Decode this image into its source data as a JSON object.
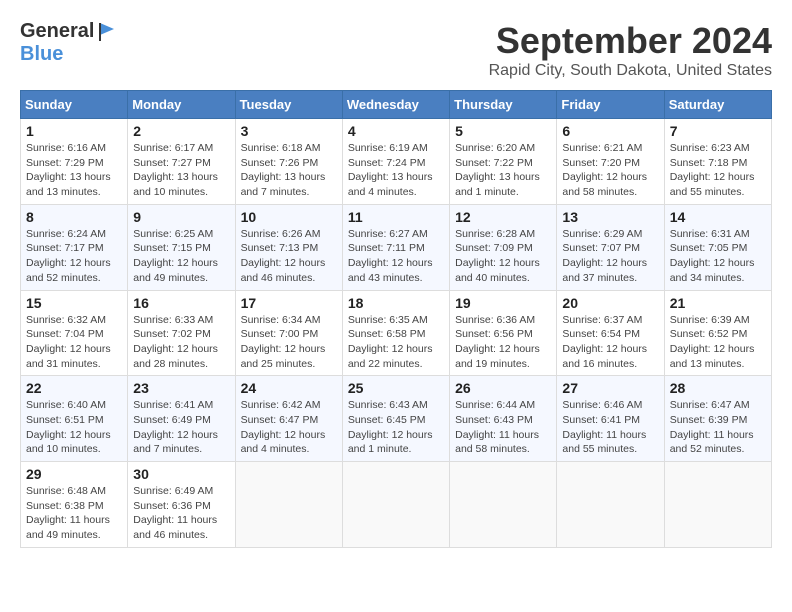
{
  "header": {
    "logo_general": "General",
    "logo_blue": "Blue",
    "month_title": "September 2024",
    "location": "Rapid City, South Dakota, United States"
  },
  "days_of_week": [
    "Sunday",
    "Monday",
    "Tuesday",
    "Wednesday",
    "Thursday",
    "Friday",
    "Saturday"
  ],
  "weeks": [
    [
      {
        "day": "1",
        "detail": "Sunrise: 6:16 AM\nSunset: 7:29 PM\nDaylight: 13 hours\nand 13 minutes."
      },
      {
        "day": "2",
        "detail": "Sunrise: 6:17 AM\nSunset: 7:27 PM\nDaylight: 13 hours\nand 10 minutes."
      },
      {
        "day": "3",
        "detail": "Sunrise: 6:18 AM\nSunset: 7:26 PM\nDaylight: 13 hours\nand 7 minutes."
      },
      {
        "day": "4",
        "detail": "Sunrise: 6:19 AM\nSunset: 7:24 PM\nDaylight: 13 hours\nand 4 minutes."
      },
      {
        "day": "5",
        "detail": "Sunrise: 6:20 AM\nSunset: 7:22 PM\nDaylight: 13 hours\nand 1 minute."
      },
      {
        "day": "6",
        "detail": "Sunrise: 6:21 AM\nSunset: 7:20 PM\nDaylight: 12 hours\nand 58 minutes."
      },
      {
        "day": "7",
        "detail": "Sunrise: 6:23 AM\nSunset: 7:18 PM\nDaylight: 12 hours\nand 55 minutes."
      }
    ],
    [
      {
        "day": "8",
        "detail": "Sunrise: 6:24 AM\nSunset: 7:17 PM\nDaylight: 12 hours\nand 52 minutes."
      },
      {
        "day": "9",
        "detail": "Sunrise: 6:25 AM\nSunset: 7:15 PM\nDaylight: 12 hours\nand 49 minutes."
      },
      {
        "day": "10",
        "detail": "Sunrise: 6:26 AM\nSunset: 7:13 PM\nDaylight: 12 hours\nand 46 minutes."
      },
      {
        "day": "11",
        "detail": "Sunrise: 6:27 AM\nSunset: 7:11 PM\nDaylight: 12 hours\nand 43 minutes."
      },
      {
        "day": "12",
        "detail": "Sunrise: 6:28 AM\nSunset: 7:09 PM\nDaylight: 12 hours\nand 40 minutes."
      },
      {
        "day": "13",
        "detail": "Sunrise: 6:29 AM\nSunset: 7:07 PM\nDaylight: 12 hours\nand 37 minutes."
      },
      {
        "day": "14",
        "detail": "Sunrise: 6:31 AM\nSunset: 7:05 PM\nDaylight: 12 hours\nand 34 minutes."
      }
    ],
    [
      {
        "day": "15",
        "detail": "Sunrise: 6:32 AM\nSunset: 7:04 PM\nDaylight: 12 hours\nand 31 minutes."
      },
      {
        "day": "16",
        "detail": "Sunrise: 6:33 AM\nSunset: 7:02 PM\nDaylight: 12 hours\nand 28 minutes."
      },
      {
        "day": "17",
        "detail": "Sunrise: 6:34 AM\nSunset: 7:00 PM\nDaylight: 12 hours\nand 25 minutes."
      },
      {
        "day": "18",
        "detail": "Sunrise: 6:35 AM\nSunset: 6:58 PM\nDaylight: 12 hours\nand 22 minutes."
      },
      {
        "day": "19",
        "detail": "Sunrise: 6:36 AM\nSunset: 6:56 PM\nDaylight: 12 hours\nand 19 minutes."
      },
      {
        "day": "20",
        "detail": "Sunrise: 6:37 AM\nSunset: 6:54 PM\nDaylight: 12 hours\nand 16 minutes."
      },
      {
        "day": "21",
        "detail": "Sunrise: 6:39 AM\nSunset: 6:52 PM\nDaylight: 12 hours\nand 13 minutes."
      }
    ],
    [
      {
        "day": "22",
        "detail": "Sunrise: 6:40 AM\nSunset: 6:51 PM\nDaylight: 12 hours\nand 10 minutes."
      },
      {
        "day": "23",
        "detail": "Sunrise: 6:41 AM\nSunset: 6:49 PM\nDaylight: 12 hours\nand 7 minutes."
      },
      {
        "day": "24",
        "detail": "Sunrise: 6:42 AM\nSunset: 6:47 PM\nDaylight: 12 hours\nand 4 minutes."
      },
      {
        "day": "25",
        "detail": "Sunrise: 6:43 AM\nSunset: 6:45 PM\nDaylight: 12 hours\nand 1 minute."
      },
      {
        "day": "26",
        "detail": "Sunrise: 6:44 AM\nSunset: 6:43 PM\nDaylight: 11 hours\nand 58 minutes."
      },
      {
        "day": "27",
        "detail": "Sunrise: 6:46 AM\nSunset: 6:41 PM\nDaylight: 11 hours\nand 55 minutes."
      },
      {
        "day": "28",
        "detail": "Sunrise: 6:47 AM\nSunset: 6:39 PM\nDaylight: 11 hours\nand 52 minutes."
      }
    ],
    [
      {
        "day": "29",
        "detail": "Sunrise: 6:48 AM\nSunset: 6:38 PM\nDaylight: 11 hours\nand 49 minutes."
      },
      {
        "day": "30",
        "detail": "Sunrise: 6:49 AM\nSunset: 6:36 PM\nDaylight: 11 hours\nand 46 minutes."
      },
      {
        "day": "",
        "detail": ""
      },
      {
        "day": "",
        "detail": ""
      },
      {
        "day": "",
        "detail": ""
      },
      {
        "day": "",
        "detail": ""
      },
      {
        "day": "",
        "detail": ""
      }
    ]
  ]
}
